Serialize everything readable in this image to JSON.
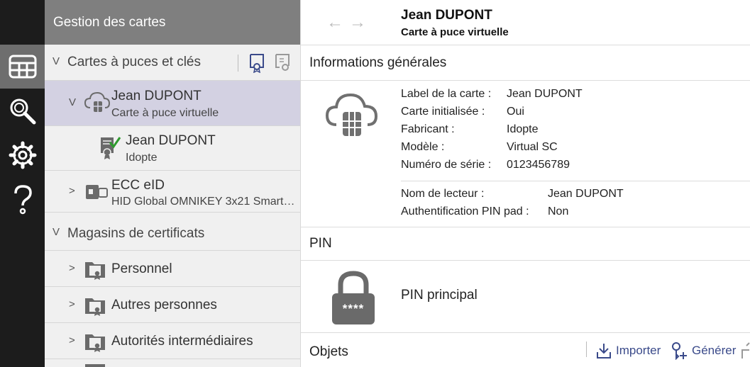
{
  "rail": {
    "items": [
      {
        "icon": "card-management-icon",
        "active": true
      },
      {
        "icon": "search-icon",
        "active": false
      },
      {
        "icon": "gear-icon",
        "active": false
      },
      {
        "icon": "help-icon",
        "active": false
      }
    ]
  },
  "tree": {
    "header": "Gestion des cartes",
    "groups": {
      "cards_title": "Cartes à puces et clés",
      "stores_title": "Magasins de certificats"
    },
    "card1": {
      "name": "Jean DUPONT",
      "sub": "Carte à puce virtuelle"
    },
    "cert1": {
      "name": "Jean DUPONT",
      "sub": "Idopte"
    },
    "card2": {
      "name": "ECC eID",
      "sub": "HID Global OMNIKEY 3x21 Smart…"
    },
    "stores": [
      "Personnel",
      "Autres personnes",
      "Autorités intermédiaires"
    ]
  },
  "main": {
    "title": "Jean DUPONT",
    "subtitle": "Carte à puce virtuelle",
    "general_title": "Informations générales",
    "card_info": [
      {
        "k": "Label de la carte :",
        "v": "Jean DUPONT"
      },
      {
        "k": "Carte initialisée :",
        "v": "Oui"
      },
      {
        "k": "Fabricant :",
        "v": "Idopte"
      },
      {
        "k": "Modèle :",
        "v": "Virtual SC"
      },
      {
        "k": "Numéro de série :",
        "v": "0123456789"
      }
    ],
    "reader_info": [
      {
        "k": "Nom de lecteur :",
        "v": "Jean DUPONT"
      },
      {
        "k": "Authentification PIN pad :",
        "v": "Non"
      }
    ],
    "pin_title": "PIN",
    "pin_label": "PIN principal",
    "pin_mask": "****",
    "objects_title": "Objets",
    "import_label": "Importer",
    "generate_label": "Générer"
  },
  "colors": {
    "selected_row": "#d3d1e2",
    "rail_bg": "#1c1c1c",
    "tree_header": "#7f7f7f",
    "accent_icon": "#3a4a8a",
    "check": "#2e9a2e"
  }
}
